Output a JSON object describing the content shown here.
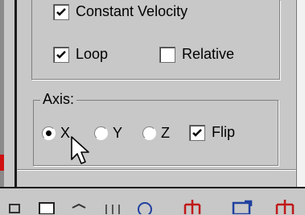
{
  "options": {
    "constant_velocity": {
      "label": "Constant Velocity",
      "checked": true
    },
    "loop": {
      "label": "Loop",
      "checked": true
    },
    "relative": {
      "label": "Relative",
      "checked": false
    }
  },
  "axis": {
    "legend": "Axis:",
    "options": [
      {
        "label": "X",
        "selected": true
      },
      {
        "label": "Y",
        "selected": false
      },
      {
        "label": "Z",
        "selected": false
      }
    ],
    "flip": {
      "label": "Flip",
      "checked": true
    }
  },
  "toolbar": {
    "icons": [
      "toolbar-icon-1",
      "select-box-icon",
      "toolbar-icon-3",
      "separator-bars-icon",
      "zoom-icon",
      "grid-red-icon",
      "viewport-icon",
      "grid-red-icon-2"
    ]
  }
}
